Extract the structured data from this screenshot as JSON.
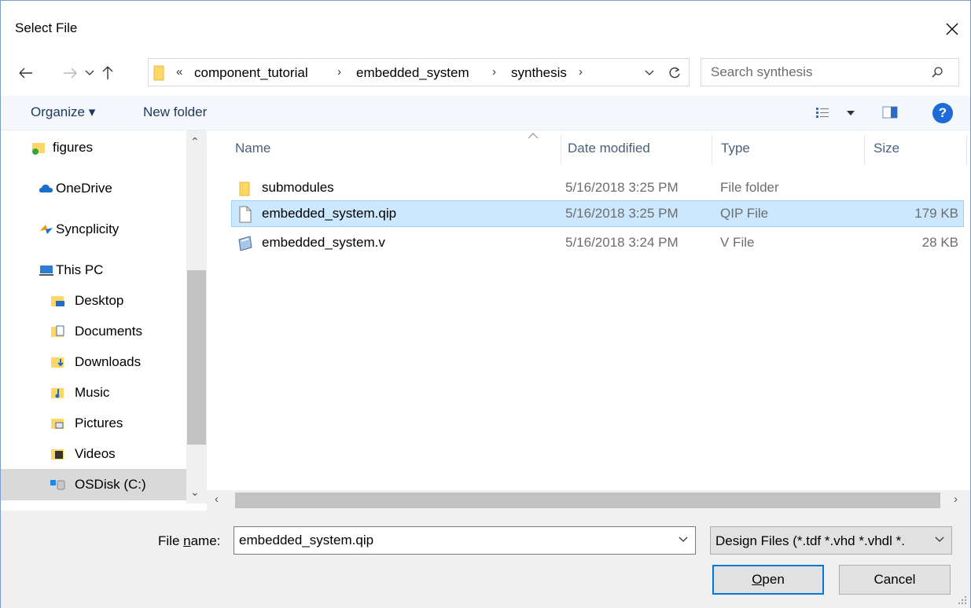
{
  "window": {
    "title": "Select File"
  },
  "nav": {
    "back_icon": "arrow-left-icon",
    "forward_icon": "arrow-right-icon",
    "recent_icon": "chevron-down-icon",
    "up_icon": "arrow-up-icon"
  },
  "address": {
    "overflow": "«",
    "segments": [
      "component_tutorial",
      "embedded_system",
      "synthesis"
    ],
    "separator": "›"
  },
  "search": {
    "placeholder": "Search synthesis"
  },
  "toolbar": {
    "organize_label": "Organize ▾",
    "new_folder_label": "New folder",
    "help_label": "?"
  },
  "sidebar": {
    "items": [
      {
        "label": "figures",
        "icon": "folder-sync-icon"
      },
      {
        "label": "OneDrive",
        "icon": "cloud-icon"
      },
      {
        "label": "Syncplicity",
        "icon": "syncplicity-icon"
      },
      {
        "label": "This PC",
        "icon": "computer-icon"
      },
      {
        "label": "Desktop",
        "icon": "desktop-folder-icon"
      },
      {
        "label": "Documents",
        "icon": "documents-folder-icon"
      },
      {
        "label": "Downloads",
        "icon": "downloads-folder-icon"
      },
      {
        "label": "Music",
        "icon": "music-folder-icon"
      },
      {
        "label": "Pictures",
        "icon": "pictures-folder-icon"
      },
      {
        "label": "Videos",
        "icon": "videos-folder-icon"
      },
      {
        "label": "OSDisk (C:)",
        "icon": "drive-icon"
      }
    ]
  },
  "columns": {
    "name": "Name",
    "date": "Date modified",
    "type": "Type",
    "size": "Size"
  },
  "files": [
    {
      "name": "submodules",
      "date": "5/16/2018 3:25 PM",
      "type": "File folder",
      "size": "",
      "icon": "folder-icon"
    },
    {
      "name": "embedded_system.qip",
      "date": "5/16/2018 3:25 PM",
      "type": "QIP File",
      "size": "179 KB",
      "icon": "file-icon"
    },
    {
      "name": "embedded_system.v",
      "date": "5/16/2018 3:24 PM",
      "type": "V File",
      "size": "28 KB",
      "icon": "v-file-icon"
    }
  ],
  "footer": {
    "filename_label_pre": "File ",
    "filename_label_u": "n",
    "filename_label_post": "ame:",
    "filename_value": "embedded_system.qip",
    "filter_value": "Design Files (*.tdf *.vhd *.vhdl *.",
    "open_u": "O",
    "open_rest": "pen",
    "cancel_label": "Cancel"
  },
  "colors": {
    "accent": "#0078d7",
    "selection": "#cce8ff",
    "folder": "#ffd766"
  }
}
